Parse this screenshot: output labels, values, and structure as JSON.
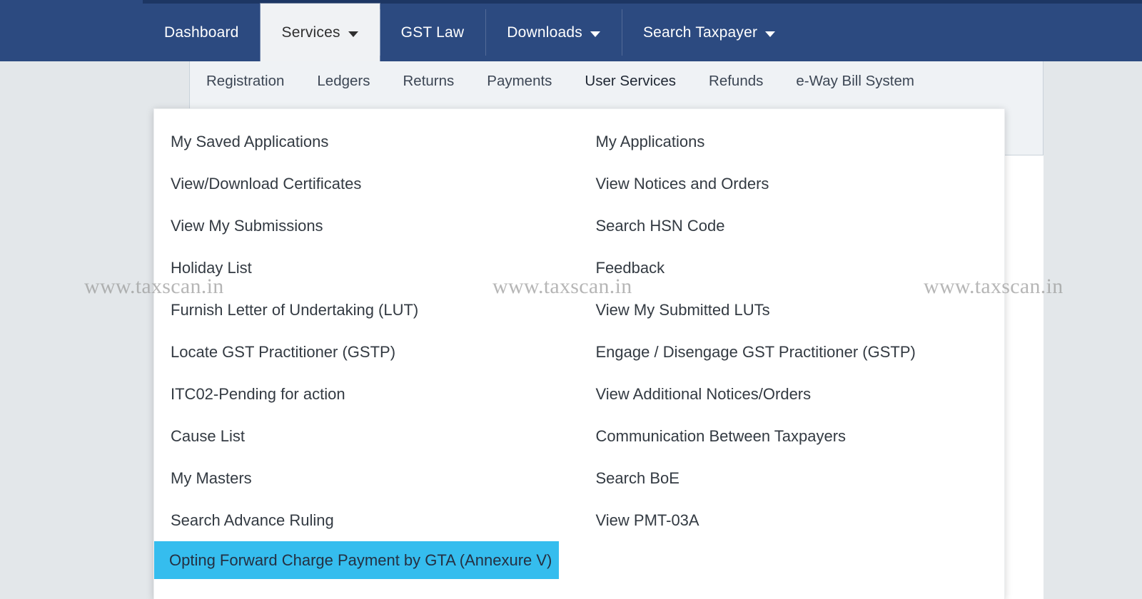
{
  "topnav": {
    "items": [
      {
        "label": "Dashboard",
        "has_caret": false,
        "active": false
      },
      {
        "label": "Services",
        "has_caret": true,
        "active": true
      },
      {
        "label": "GST Law",
        "has_caret": false,
        "active": false
      },
      {
        "label": "Downloads",
        "has_caret": true,
        "active": false
      },
      {
        "label": "Search Taxpayer",
        "has_caret": true,
        "active": false
      }
    ],
    "background_color": "#2c4a80",
    "active_background_color": "#f0f2f4"
  },
  "subnav": {
    "items": [
      {
        "label": "Registration",
        "active": false
      },
      {
        "label": "Ledgers",
        "active": false
      },
      {
        "label": "Returns",
        "active": false
      },
      {
        "label": "Payments",
        "active": false
      },
      {
        "label": "User Services",
        "active": true
      },
      {
        "label": "Refunds",
        "active": false
      },
      {
        "label": "e-Way Bill System",
        "active": false
      }
    ],
    "background_color": "#eff2f5",
    "active_underline_color": "#1c2633"
  },
  "dropdown": {
    "left_column": [
      {
        "label": "My Saved Applications",
        "highlighted": false
      },
      {
        "label": "View/Download Certificates",
        "highlighted": false
      },
      {
        "label": "View My Submissions",
        "highlighted": false
      },
      {
        "label": "Holiday List",
        "highlighted": false
      },
      {
        "label": "Furnish Letter of Undertaking (LUT)",
        "highlighted": false
      },
      {
        "label": "Locate GST Practitioner (GSTP)",
        "highlighted": false
      },
      {
        "label": "ITC02-Pending for action",
        "highlighted": false
      },
      {
        "label": "Cause List",
        "highlighted": false
      },
      {
        "label": "My Masters",
        "highlighted": false
      },
      {
        "label": "Search Advance Ruling",
        "highlighted": false
      },
      {
        "label": "Opting Forward Charge Payment by GTA (Annexure V)",
        "highlighted": true
      }
    ],
    "right_column": [
      {
        "label": "My Applications",
        "highlighted": false
      },
      {
        "label": "View Notices and Orders",
        "highlighted": false
      },
      {
        "label": "Search HSN Code",
        "highlighted": false
      },
      {
        "label": "Feedback",
        "highlighted": false
      },
      {
        "label": "View My Submitted LUTs",
        "highlighted": false
      },
      {
        "label": "Engage / Disengage GST Practitioner (GSTP)",
        "highlighted": false
      },
      {
        "label": "View Additional Notices/Orders",
        "highlighted": false
      },
      {
        "label": "Communication Between Taxpayers",
        "highlighted": false
      },
      {
        "label": "Search BoE",
        "highlighted": false
      },
      {
        "label": "View PMT-03A",
        "highlighted": false
      }
    ],
    "highlight_color": "#35bdee",
    "panel_background_color": "#ffffff"
  },
  "watermarks": {
    "left": "www.taxscan.in",
    "center": "www.taxscan.in",
    "right": "www.taxscan.in"
  }
}
